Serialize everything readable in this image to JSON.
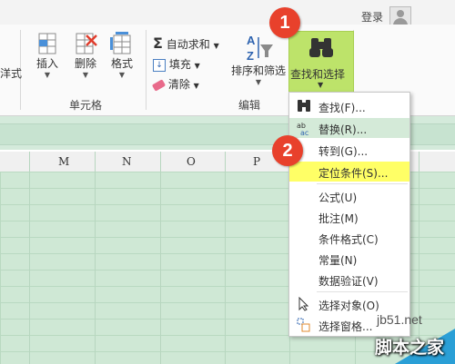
{
  "header": {
    "login_label": "登录"
  },
  "ribbon": {
    "left_partial_label": "洋式",
    "cells_group": {
      "label": "单元格",
      "buttons": [
        {
          "label": "插入"
        },
        {
          "label": "删除"
        },
        {
          "label": "格式"
        }
      ]
    },
    "edit_group": {
      "label": "编辑",
      "autosum_label": "自动求和",
      "fill_label": "填充",
      "clear_label": "清除",
      "sort_filter_label": "排序和筛选",
      "find_select_label": "查找和选择"
    }
  },
  "columns": [
    "M",
    "N",
    "O",
    "P"
  ],
  "menu": {
    "items": [
      {
        "label": "查找(F)...",
        "icon": "binoculars-icon"
      },
      {
        "label": "替换(R)...",
        "icon": "replace-icon",
        "state": "hover"
      },
      {
        "label": "转到(G)...",
        "icon": ""
      },
      {
        "label": "定位条件(S)...",
        "icon": "",
        "state": "highlight"
      },
      {
        "label": "公式(U)",
        "icon": ""
      },
      {
        "label": "批注(M)",
        "icon": ""
      },
      {
        "label": "条件格式(C)",
        "icon": ""
      },
      {
        "label": "常量(N)",
        "icon": ""
      },
      {
        "label": "数据验证(V)",
        "icon": ""
      },
      {
        "label": "选择对象(O)",
        "icon": "cursor-icon"
      },
      {
        "label": "选择窗格...",
        "icon": "selection-pane-icon"
      }
    ]
  },
  "annotations": {
    "step1": "1",
    "step2": "2"
  },
  "watermark": {
    "site": "jb51.net",
    "name": "脚本之家"
  },
  "colors": {
    "find_button_bg": "#bde36a",
    "badge": "#e8412c",
    "highlight": "#ffff66",
    "grid": "#cfe8d5"
  }
}
